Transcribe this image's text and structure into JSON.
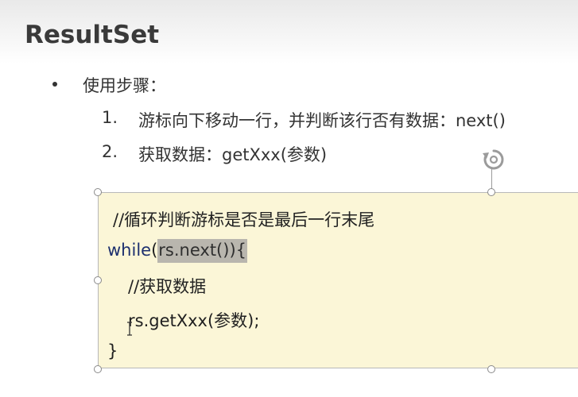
{
  "slide": {
    "title": "ResultSet",
    "bullet": "使用步骤：",
    "steps": [
      {
        "num": "1.",
        "text": "游标向下移动一行，并判断该行否有数据：next()"
      },
      {
        "num": "2.",
        "text": "获取数据：getXxx(参数)"
      }
    ]
  },
  "code": {
    "line1": "//循环判断游标是否是最后一行末尾",
    "line2_keyword": "while",
    "line2_open": "(",
    "line2_selected": "rs.next()){",
    "line3": "//获取数据",
    "line4": "rs.getXxx(参数);",
    "line5": "}"
  },
  "icons": {
    "rotate": "rotate-handle-icon",
    "cursor": "text-cursor-icon"
  },
  "colors": {
    "code_background": "#fbf6d7",
    "keyword": "#1c2f6e",
    "selection": "#b9b6ae",
    "title": "#3a3a3a"
  }
}
